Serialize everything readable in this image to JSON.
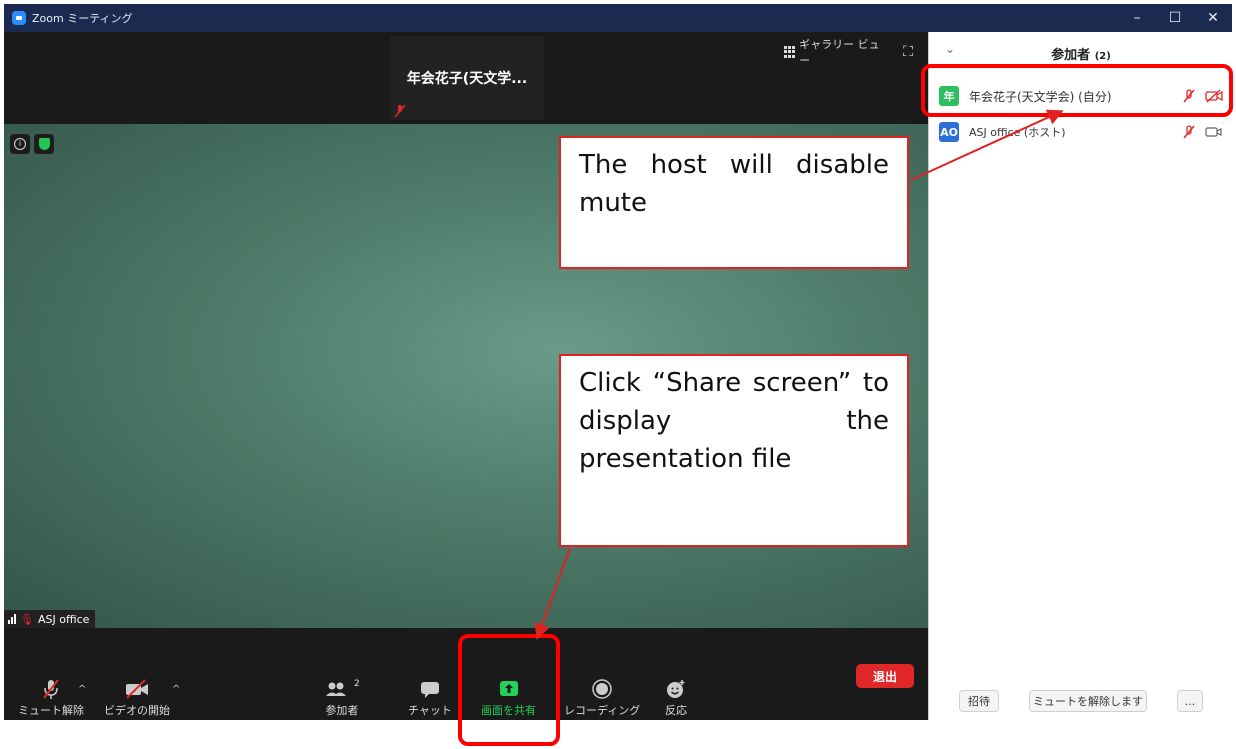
{
  "window": {
    "title": "Zoom ミーティング"
  },
  "thumbnail": {
    "name": "年会花子(天文学..."
  },
  "view": {
    "gallery_label": "ギャラリー ビュー"
  },
  "main_video": {
    "name_tag": "ASJ office"
  },
  "toolbar": {
    "unmute_label": "ミュート解除",
    "start_video_label": "ビデオの開始",
    "participants_label": "参加者",
    "participants_count": "2",
    "chat_label": "チャット",
    "share_label": "画面を共有",
    "record_label": "レコーディング",
    "reactions_label": "反応",
    "leave_label": "退出"
  },
  "panel": {
    "title": "参加者",
    "count": "(2)",
    "participants": [
      {
        "avatar": "年",
        "name": "年会花子(天文学会) (自分)",
        "avatar_color": "#2dbe60"
      },
      {
        "avatar": "AO",
        "name": "ASJ office (ホスト)",
        "avatar_color": "#2d6fd6"
      }
    ],
    "invite_label": "招待",
    "unmute_all_label": "ミュートを解除します",
    "more_label": "..."
  },
  "annotations": {
    "host_note": "The host will disable mute",
    "share_note": "Click “Share screen” to display the presentation file"
  },
  "colors": {
    "accent_red": "#e02222",
    "share_green": "#23d05a",
    "titlebar": "#1b2b4f"
  }
}
